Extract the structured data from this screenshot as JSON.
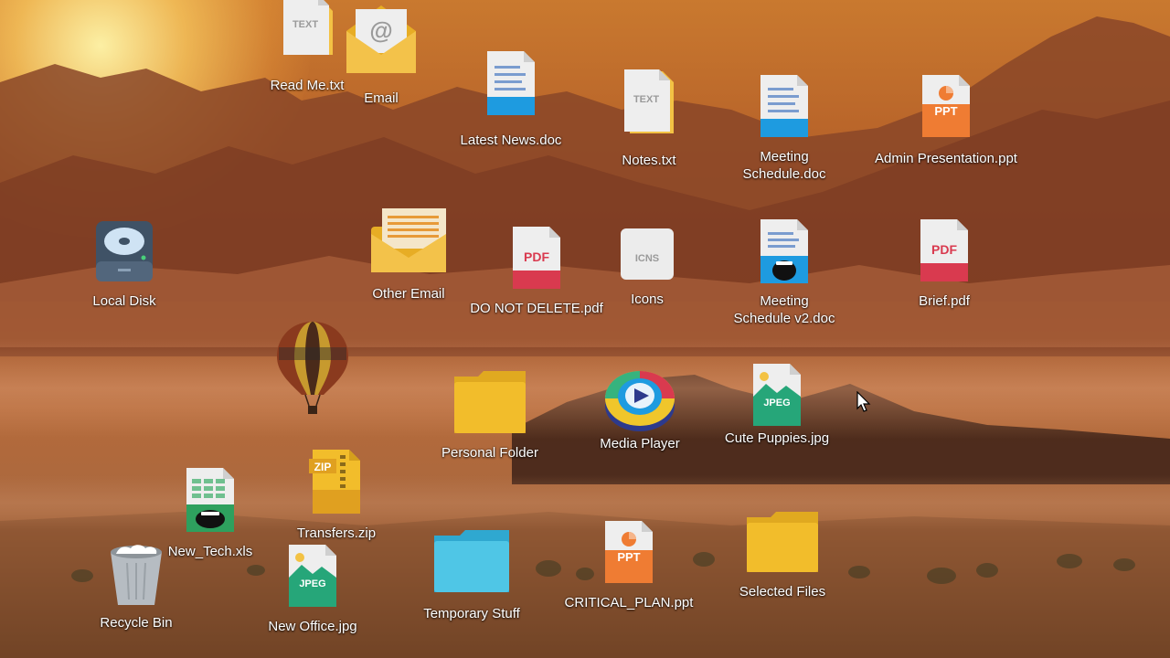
{
  "desktop": {
    "icons": [
      {
        "label": "Read Me.txt",
        "icon": "text-file-icon",
        "badge": "TEXT"
      },
      {
        "label": "Email",
        "icon": "email-envelope-icon",
        "badge": "@"
      },
      {
        "label": "Latest News.doc",
        "icon": "word-document-icon"
      },
      {
        "label": "Notes.txt",
        "icon": "text-file-icon",
        "badge": "TEXT"
      },
      {
        "label": "Meeting\nSchedule.doc",
        "icon": "word-document-icon"
      },
      {
        "label": "Admin Presentation.ppt",
        "icon": "powerpoint-file-icon",
        "badge": "PPT"
      },
      {
        "label": "Local Disk",
        "icon": "hard-disk-icon"
      },
      {
        "label": "Other Email",
        "icon": "open-envelope-icon"
      },
      {
        "label": "DO NOT DELETE.pdf",
        "icon": "pdf-file-icon",
        "badge": "PDF"
      },
      {
        "label": "Icons",
        "icon": "icns-file-icon",
        "badge": "ICNS"
      },
      {
        "label": "Meeting\nSchedule v2.doc",
        "icon": "screaming-document-icon"
      },
      {
        "label": "Brief.pdf",
        "icon": "pdf-file-icon",
        "badge": "PDF"
      },
      {
        "label": "Personal Folder",
        "icon": "yellow-folder-icon"
      },
      {
        "label": "Media Player",
        "icon": "media-player-disc-icon"
      },
      {
        "label": "Cute Puppies.jpg",
        "icon": "jpeg-image-icon",
        "badge": "JPEG"
      },
      {
        "label": "New_Tech.xls",
        "icon": "screaming-spreadsheet-icon"
      },
      {
        "label": "Transfers.zip",
        "icon": "zip-archive-icon",
        "badge": "ZIP"
      },
      {
        "label": "Recycle Bin",
        "icon": "recycle-bin-icon"
      },
      {
        "label": "New Office.jpg",
        "icon": "jpeg-image-icon",
        "badge": "JPEG"
      },
      {
        "label": "Temporary Stuff",
        "icon": "blue-folder-icon"
      },
      {
        "label": "CRITICAL_PLAN.ppt",
        "icon": "powerpoint-file-icon",
        "badge": "PPT"
      },
      {
        "label": "Selected Files",
        "icon": "yellow-folder-icon"
      }
    ]
  },
  "colors": {
    "doc_blue": "#1e9be0",
    "pdf_red": "#d93a4f",
    "ppt_orange": "#ef7c33",
    "jpeg_green": "#26a679",
    "folder_yellow": "#f2bd2b",
    "folder_blue": "#4fc6e6"
  }
}
